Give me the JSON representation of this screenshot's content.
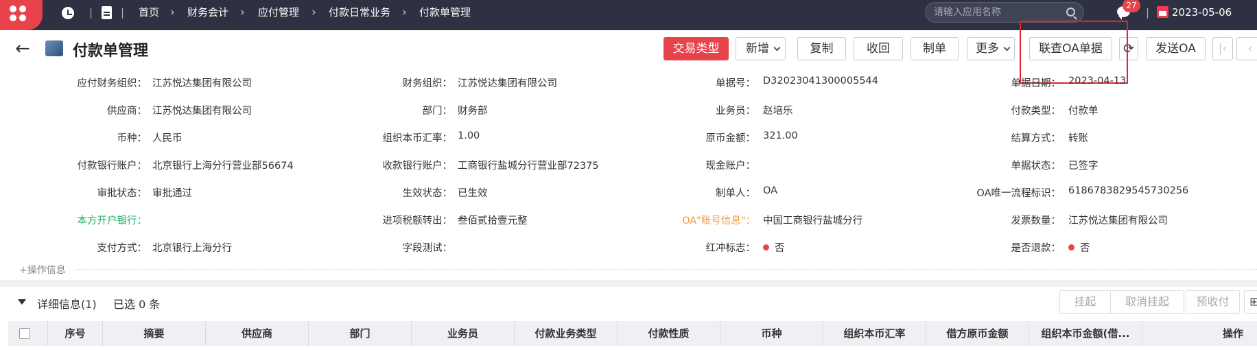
{
  "topbar": {
    "breadcrumb": [
      "首页",
      "财务会计",
      "应付管理",
      "付款日常业务",
      "付款单管理"
    ],
    "search_placeholder": "请输入应用名称",
    "notifications": "27",
    "date": "2023-05-06"
  },
  "header": {
    "title": "付款单管理",
    "buttons": {
      "trade_type": "交易类型",
      "add": "新增",
      "copy": "复制",
      "recall": "收回",
      "make": "制单",
      "more": "更多",
      "oa_query": "联查OA单据",
      "send_oa": "发送OA"
    }
  },
  "form": {
    "row1": {
      "l1": "应付财务组织：",
      "v1": "江苏悦达集团有限公司",
      "l2": "财务组织：",
      "v2": "江苏悦达集团有限公司",
      "l3": "单据号：",
      "v3": "D32023041300005544",
      "l4": "单据日期：",
      "v4": "2023-04-13"
    },
    "row2": {
      "l1": "供应商：",
      "v1": "江苏悦达集团有限公司",
      "l2": "部门：",
      "v2": "财务部",
      "l3": "业务员：",
      "v3": "赵培乐",
      "l4": "付款类型：",
      "v4": "付款单"
    },
    "row3": {
      "l1": "币种：",
      "v1": "人民币",
      "l2": "组织本币汇率：",
      "v2": "1.00",
      "l3": "原币金额：",
      "v3": "321.00",
      "l4": "结算方式：",
      "v4": "转账"
    },
    "row4": {
      "l1": "付款银行账户：",
      "v1": "北京银行上海分行营业部56674",
      "l2": "收款银行账户：",
      "v2": "工商银行盐城分行营业部72375",
      "l3": "现金账户：",
      "v3": "",
      "l4": "单据状态：",
      "v4": "已签字"
    },
    "row5": {
      "l1": "审批状态：",
      "v1": "审批通过",
      "l2": "生效状态：",
      "v2": "已生效",
      "l3": "制单人：",
      "v3": "OA",
      "l4": "OA唯一流程标识：",
      "v4": "6186783829545730256"
    },
    "row6": {
      "l1": "本方开户银行：",
      "v1": "",
      "l2": "进项税额转出：",
      "v2": "叁佰贰拾壹元整",
      "l3": "OA\"账号信息\"：",
      "v3": "中国工商银行盐城分行",
      "l4": "发票数量：",
      "v4": "江苏悦达集团有限公司"
    },
    "row7": {
      "l1": "支付方式：",
      "v1": "北京银行上海分行",
      "l2": "字段测试：",
      "v2": "",
      "l3": "红冲标志：",
      "v3": "否",
      "l4": "是否退款：",
      "v4": "否"
    },
    "oplog": "+操作信息"
  },
  "detail": {
    "title": "详细信息(1)",
    "selected": "已选 0 条",
    "buttons": [
      "挂起",
      "取消挂起",
      "预收付"
    ],
    "columns": [
      "序号",
      "摘要",
      "供应商",
      "部门",
      "业务员",
      "付款业务类型",
      "付款性质",
      "币种",
      "组织本币汇率",
      "借方原币金额",
      "组织本币金额(借...",
      "操作"
    ]
  },
  "colors": {
    "brand": "#e8424a",
    "topbar": "#2d3142"
  }
}
